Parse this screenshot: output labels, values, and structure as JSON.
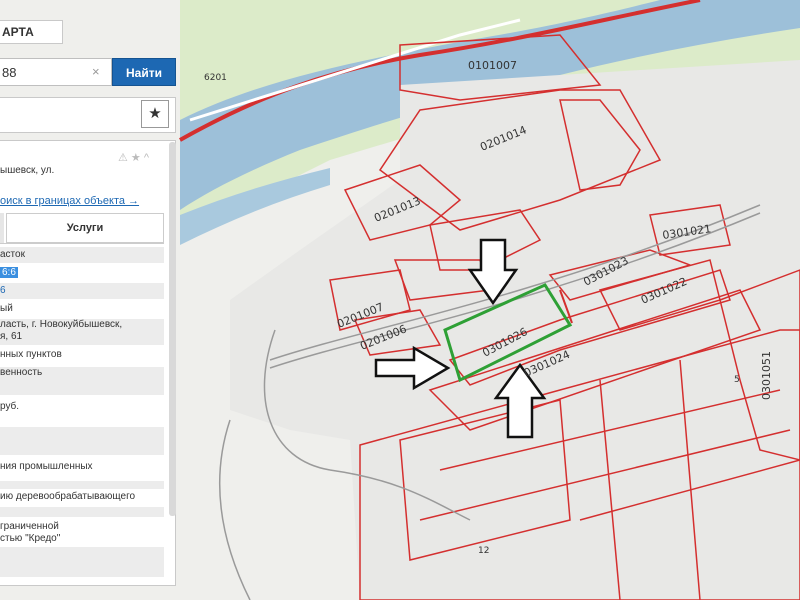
{
  "map": {
    "parcels": [
      {
        "id": "0101007"
      },
      {
        "id": "0201014"
      },
      {
        "id": "0201013"
      },
      {
        "id": "0201007"
      },
      {
        "id": "0201006"
      },
      {
        "id": "0301021"
      },
      {
        "id": "0301023"
      },
      {
        "id": "0301022"
      },
      {
        "id": "0301026"
      },
      {
        "id": "0301024"
      },
      {
        "id": "0301051"
      }
    ],
    "road_number": "6201",
    "small_numbers": [
      "12",
      "5"
    ],
    "colors": {
      "boundary": "#d42f2f",
      "highlight": "#2ea035",
      "river": "#9dc0d9",
      "green": "#d8e8c4",
      "road": "#ffffff"
    }
  },
  "panel": {
    "title": "АРТА",
    "search": {
      "value": "88",
      "clear_icon": "×",
      "button": "Найти"
    },
    "star_icon": "★",
    "card": {
      "address_line": "ышевск, ул.",
      "icons": "⚠ ★ ^",
      "search_link": "оиск в границах объекта →",
      "tab_services": "Услуги",
      "rows": [
        "асток",
        "6:6",
        "6",
        "ый",
        "ласть, г. Новокуйбышевск,",
        "я, 61",
        "нных пунктов",
        "венность",
        "",
        "руб.",
        "",
        "",
        "ния промышленных",
        "",
        "ию деревообрабатывающего",
        "",
        "граниченной",
        "стью \"Кредо\"",
        ""
      ]
    }
  }
}
